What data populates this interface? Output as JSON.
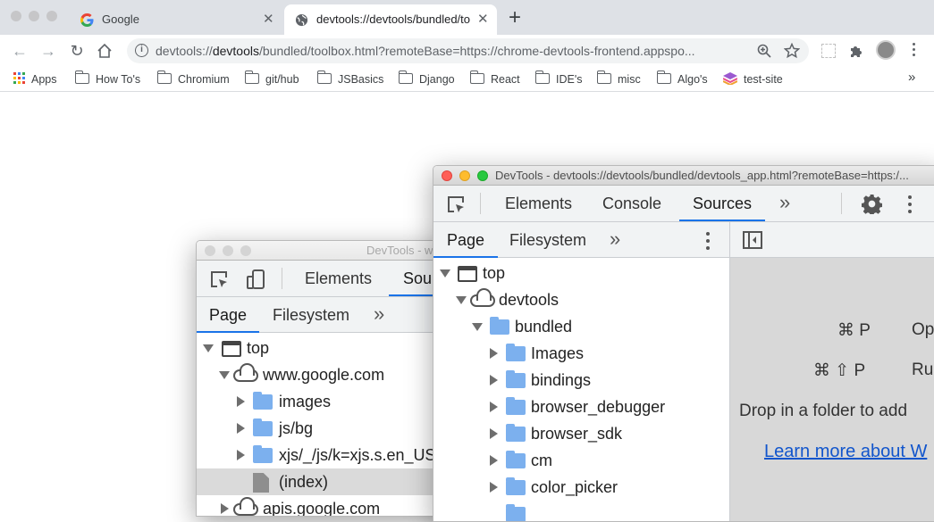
{
  "browser": {
    "tabs": [
      {
        "title": "Google",
        "active": false
      },
      {
        "title": "devtools://devtools/bundled/to",
        "active": true
      }
    ],
    "new_tab": "+",
    "url_prefix": "devtools://",
    "url_host": "devtools",
    "url_rest": "/bundled/toolbox.html?remoteBase=https://chrome-devtools-frontend.appspo...",
    "bookmarks": [
      "Apps",
      "How To's",
      "Chromium",
      "git/hub",
      "JSBasics",
      "Django",
      "React",
      "IDE's",
      "misc",
      "Algo's",
      "test-site"
    ],
    "bookmarks_more": "»"
  },
  "back_window": {
    "title": "DevTools - w",
    "main_tabs": [
      "Elements",
      "Sour"
    ],
    "sub_tabs": [
      "Page",
      "Filesystem"
    ],
    "more": "»",
    "tree": {
      "top": "top",
      "origin": "www.google.com",
      "folders": [
        "images",
        "js/bg",
        "xjs/_/js/k=xjs.s.en_US"
      ],
      "file": "(index)",
      "next_origin": "apis.google.com"
    }
  },
  "front_window": {
    "title": "DevTools - devtools://devtools/bundled/devtools_app.html?remoteBase=https:/...",
    "main_tabs": [
      "Elements",
      "Console",
      "Sources"
    ],
    "sub_tabs": [
      "Page",
      "Filesystem"
    ],
    "more": "»",
    "tree": {
      "top": "top",
      "origin": "devtools",
      "folder": "bundled",
      "children": [
        "Images",
        "bindings",
        "browser_debugger",
        "browser_sdk",
        "cm",
        "color_picker"
      ]
    },
    "editor": {
      "shortcut1_keys": "⌘ P",
      "shortcut1_label": "Op",
      "shortcut2_keys": "⌘ ⇧ P",
      "shortcut2_label": "Ru",
      "drop_text": "Drop in a folder to add",
      "learn_more": "Learn more about W"
    }
  },
  "colors": {
    "accent": "#1a73e8",
    "folder": "#7cb0ee"
  }
}
